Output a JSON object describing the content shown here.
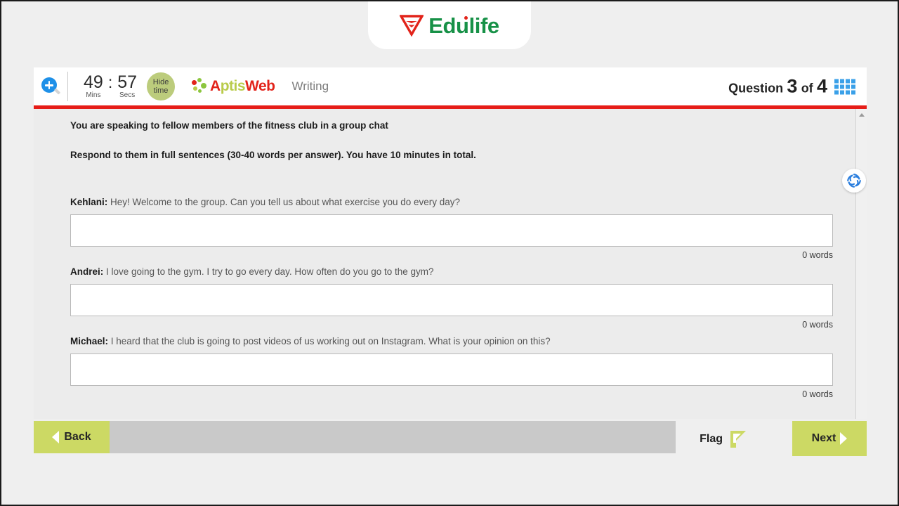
{
  "brand": {
    "name": "Edulife",
    "logo_icon": "edulife-triangle-mark",
    "text_color": "#179147",
    "mark_color": "#e2231a"
  },
  "exam_header": {
    "zoom_icon": "magnifier-plus-icon",
    "timer": {
      "minutes": "49",
      "separator": ":",
      "seconds": "57",
      "minutes_label": "Mins",
      "seconds_label": "Secs"
    },
    "hide_time": {
      "line1": "Hide",
      "line2": "time",
      "color": "#bccc7c"
    },
    "product_logo": {
      "part1": "A",
      "part2": "ptis",
      "part3": "Web",
      "dots_icon": "aptis-dots-icon",
      "red": "#e2231a",
      "olive": "#b9cb4a"
    },
    "section": "Writing",
    "question_counter": {
      "prefix": "Question",
      "current": "3",
      "middle": "of",
      "total": "4"
    },
    "grid_icon": "question-grid-icon",
    "accent_rule_color": "#e61d18"
  },
  "task": {
    "instruction_1": "You are speaking to fellow members of the fitness club in a group chat",
    "instruction_2": "Respond to them in full sentences (30-40 words per answer). You have 10 minutes in total.",
    "items": [
      {
        "speaker": "Kehlani:",
        "message": "Hey! Welcome to the group. Can you tell us about what exercise you do every day?",
        "answer_value": "",
        "word_count": "0 words"
      },
      {
        "speaker": "Andrei:",
        "message": "I love going to the gym. I try to go every day. How often do you go to the gym?",
        "answer_value": "",
        "word_count": "0 words"
      },
      {
        "speaker": "Michael:",
        "message": "I heard that the club is going to post videos of us working out on Instagram. What is your opinion on this?",
        "answer_value": "",
        "word_count": "0 words"
      }
    ]
  },
  "helper": {
    "swirl_icon": "blue-swirl-icon",
    "color": "#2a7ede"
  },
  "footer": {
    "back_label": "Back",
    "back_icon": "triangle-left-icon",
    "flag_label": "Flag",
    "flag_icon": "flag-icon",
    "next_label": "Next",
    "next_icon": "triangle-right-icon",
    "button_color": "#ccd964",
    "track_color": "#c9c9c9"
  }
}
